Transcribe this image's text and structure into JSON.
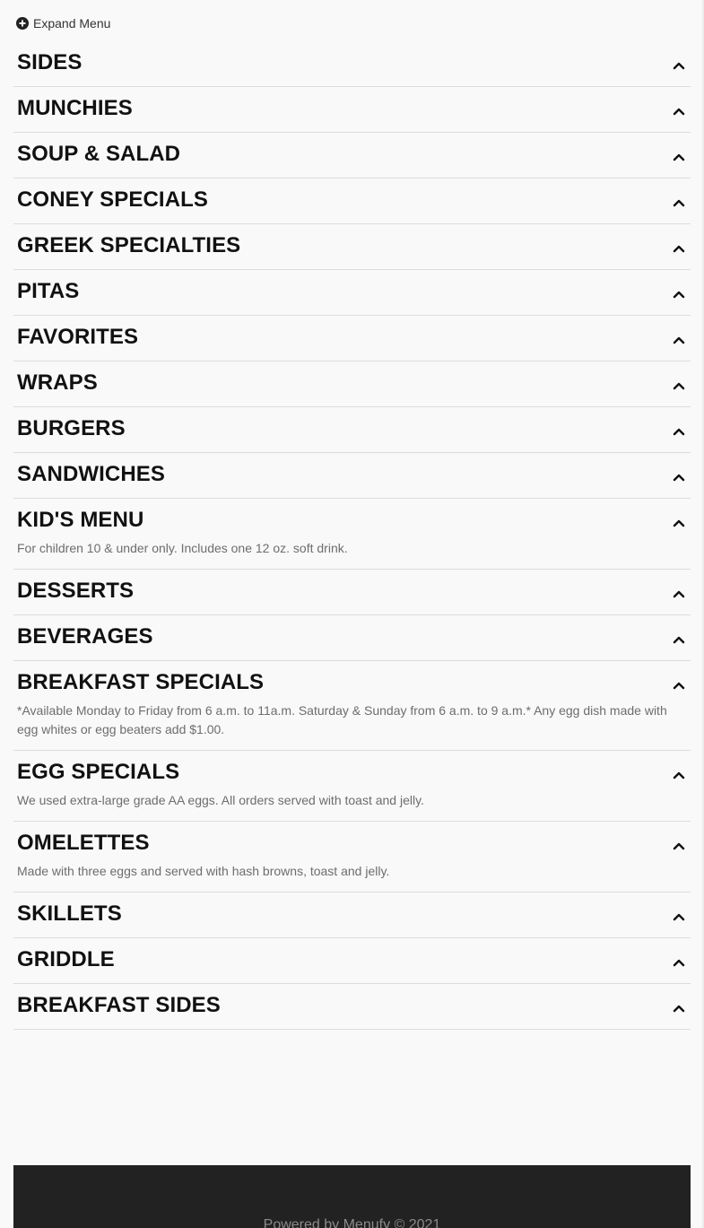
{
  "toolbar": {
    "expand_label": "Expand Menu",
    "expand_icon": "plus-circle-icon"
  },
  "sections": [
    {
      "title": "SIDES",
      "description": ""
    },
    {
      "title": "MUNCHIES",
      "description": ""
    },
    {
      "title": "SOUP & SALAD",
      "description": ""
    },
    {
      "title": "CONEY SPECIALS",
      "description": ""
    },
    {
      "title": "GREEK SPECIALTIES",
      "description": ""
    },
    {
      "title": "PITAS",
      "description": ""
    },
    {
      "title": "FAVORITES",
      "description": ""
    },
    {
      "title": "WRAPS",
      "description": ""
    },
    {
      "title": "BURGERS",
      "description": ""
    },
    {
      "title": "SANDWICHES",
      "description": ""
    },
    {
      "title": "KID'S MENU",
      "description": "For children 10 & under only. Includes one 12 oz. soft drink."
    },
    {
      "title": "DESSERTS",
      "description": ""
    },
    {
      "title": "BEVERAGES",
      "description": ""
    },
    {
      "title": "BREAKFAST SPECIALS",
      "description": "*Available Monday to Friday from 6 a.m. to 11a.m. Saturday & Sunday from 6 a.m. to 9 a.m.* Any egg dish made with egg whites or egg beaters add $1.00."
    },
    {
      "title": "EGG SPECIALS",
      "description": "We used extra-large grade AA eggs. All orders served with toast and jelly."
    },
    {
      "title": "OMELETTES",
      "description": "Made with three eggs and served with hash browns, toast and jelly."
    },
    {
      "title": "SKILLETS",
      "description": ""
    },
    {
      "title": "GRIDDLE",
      "description": ""
    },
    {
      "title": "BREAKFAST SIDES",
      "description": ""
    }
  ],
  "section_icon": "chevron-up-icon",
  "footer": {
    "text": "Powered by Menufy © 2021"
  },
  "colors": {
    "background": "#f9f9fa",
    "title": "#111111",
    "description": "#6d6d6d",
    "divider": "#dcdcdc",
    "footer_bg": "#222222",
    "footer_text": "#8a8a8a"
  }
}
